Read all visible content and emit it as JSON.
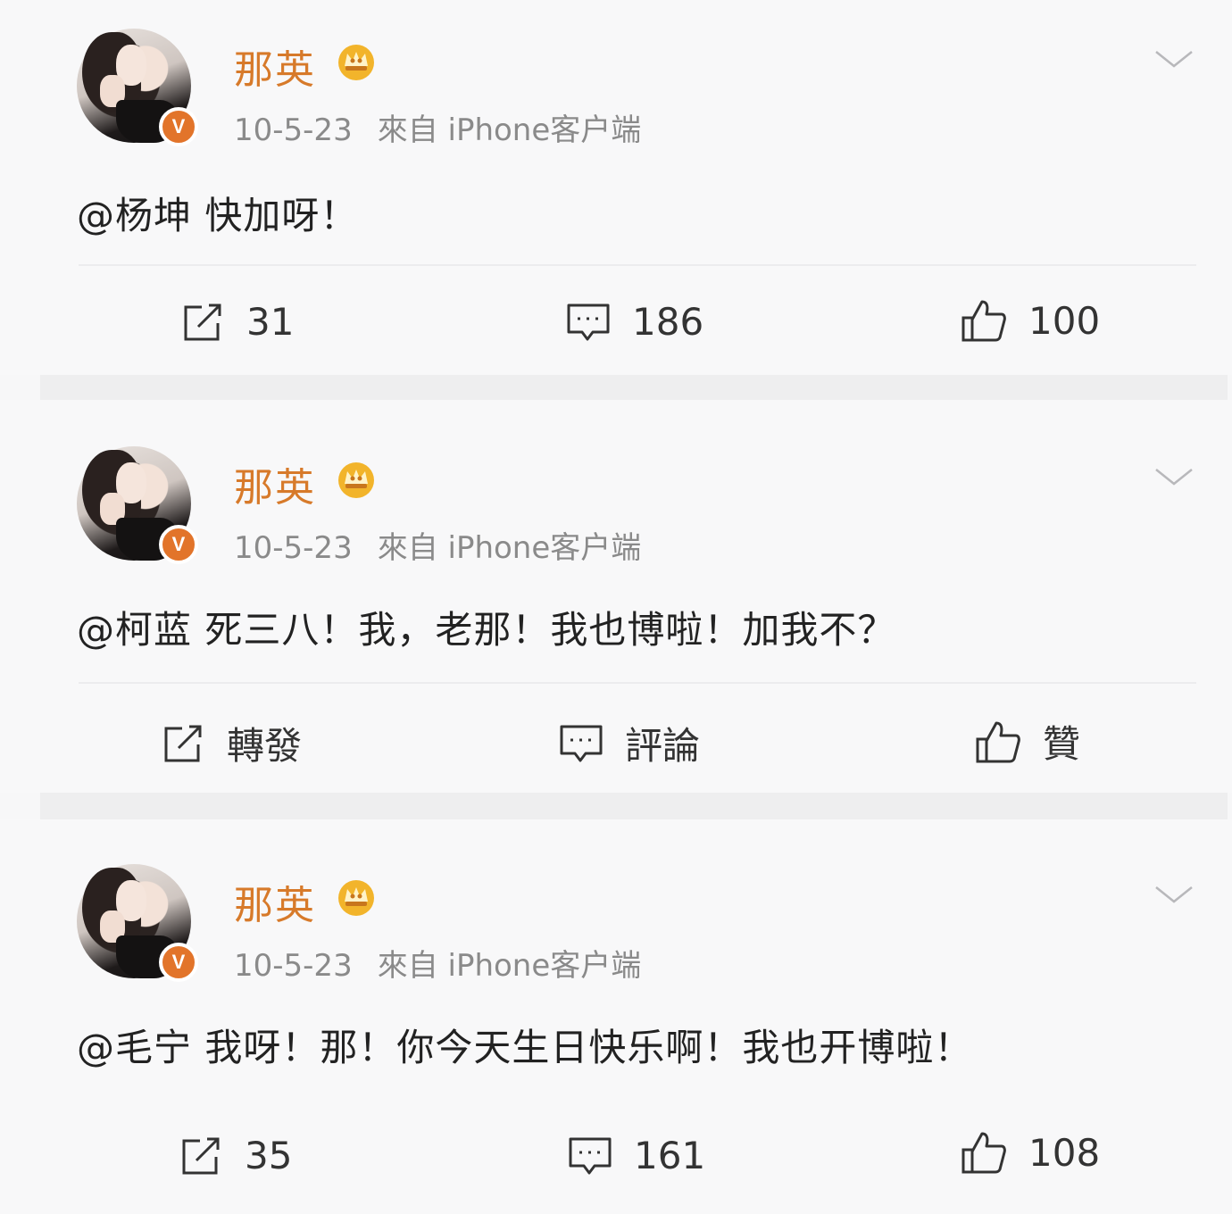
{
  "posts": [
    {
      "author": "那英",
      "badge": "V",
      "time": "10-5-23",
      "source": "來自 iPhone客户端",
      "text": "@杨坤 快加呀！",
      "repost_label": "31",
      "comment_label": "186",
      "like_label": "100"
    },
    {
      "author": "那英",
      "badge": "V",
      "time": "10-5-23",
      "source": "來自 iPhone客户端",
      "text": "@柯蓝 死三八！我，老那！我也博啦！加我不？",
      "repost_label": "轉發",
      "comment_label": "評論",
      "like_label": "贊"
    },
    {
      "author": "那英",
      "badge": "V",
      "time": "10-5-23",
      "source": "來自 iPhone客户端",
      "text": "@毛宁 我呀！那！你今天生日快乐啊！我也开博啦！",
      "repost_label": "35",
      "comment_label": "161",
      "like_label": "108"
    }
  ],
  "icons": {
    "repost": "repost-icon",
    "comment": "comment-icon",
    "like": "thumbs-up-icon",
    "more": "chevron-down-icon",
    "vip": "crown-icon"
  },
  "colors": {
    "name": "#d77a2a",
    "verified_badge": "#e2742a",
    "crown": "#f2b42b",
    "meta": "#8a8a8a"
  }
}
